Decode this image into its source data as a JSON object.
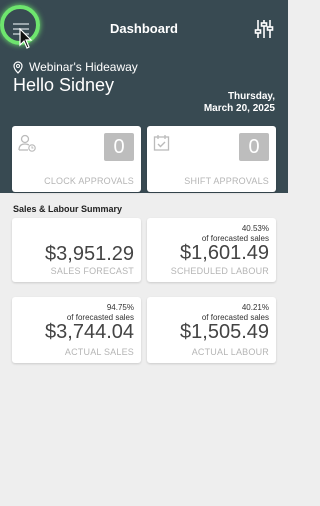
{
  "header": {
    "title": "Dashboard",
    "location": "Webinar's Hideaway",
    "greeting": "Hello Sidney",
    "date_line1": "Thursday,",
    "date_line2": "March 20, 2025"
  },
  "approvals": [
    {
      "label": "CLOCK APPROVALS",
      "count": "0",
      "icon": "user-clock-icon"
    },
    {
      "label": "SHIFT APPROVALS",
      "count": "0",
      "icon": "calendar-check-icon"
    }
  ],
  "summary": {
    "title": "Sales & Labour Summary",
    "cards": [
      {
        "label": "SALES FORECAST",
        "amount": "$3,951.29"
      },
      {
        "pct": "40.53%",
        "pct_note": "of forecasted sales",
        "label": "SCHEDULED LABOUR",
        "amount": "$1,601.49"
      },
      {
        "pct": "94.75%",
        "pct_note": "of forecasted sales",
        "label": "ACTUAL SALES",
        "amount": "$3,744.04"
      },
      {
        "pct": "40.21%",
        "pct_note": "of forecasted sales",
        "label": "ACTUAL LABOUR",
        "amount": "$1,505.49"
      }
    ]
  },
  "colors": {
    "header_bg": "#384a52",
    "page_bg": "#eeeeee",
    "highlight": "#6ee56e"
  }
}
